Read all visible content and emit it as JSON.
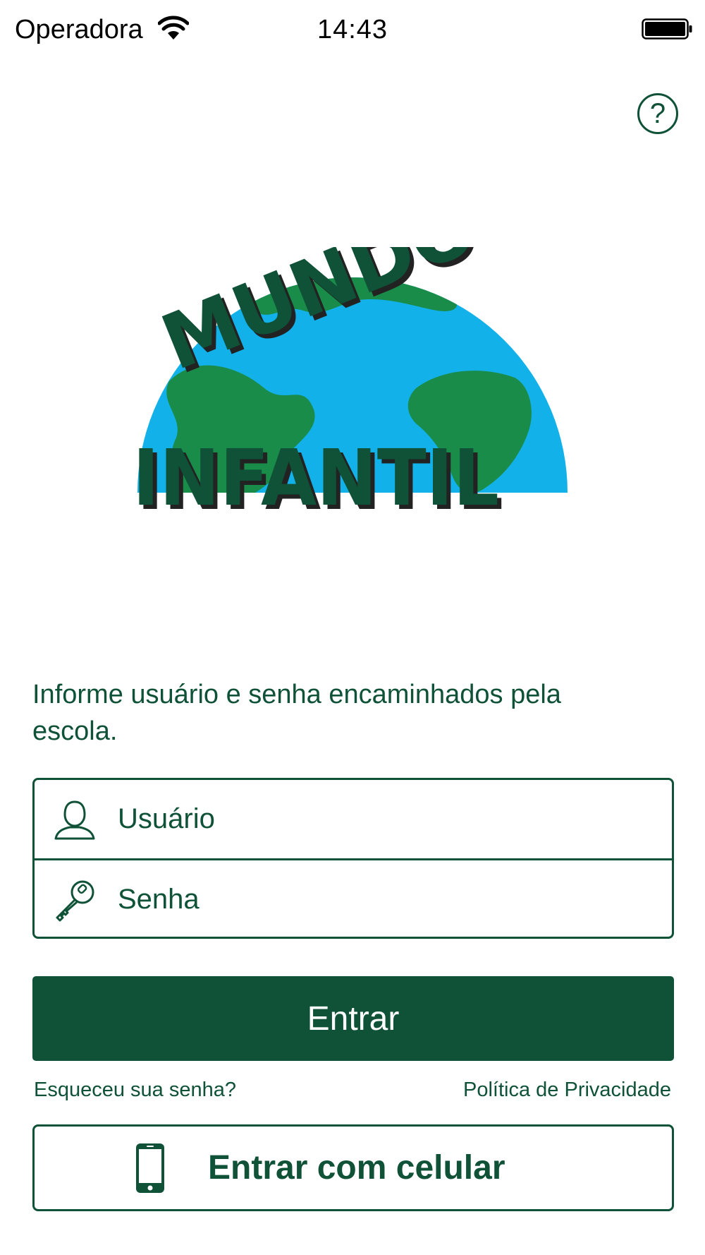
{
  "status_bar": {
    "carrier": "Operadora",
    "time": "14:43",
    "wifi_icon": "wifi-icon",
    "battery_icon": "battery-icon",
    "battery_level_percent": 95
  },
  "header": {
    "help_label": "?",
    "help_icon": "question-circle-icon"
  },
  "logo": {
    "line1": "MUNDO",
    "line2": "INFANTIL",
    "colors": {
      "ocean": "#13b1ea",
      "land": "#1a8c4a",
      "letters": "#0f5237",
      "letter_shadow": "#222222"
    }
  },
  "login": {
    "instruction": "Informe usuário e senha encaminhados pela escola.",
    "username_placeholder": "Usuário",
    "username_value": "",
    "username_icon": "user-icon",
    "password_placeholder": "Senha",
    "password_value": "",
    "password_icon": "key-icon",
    "submit_label": "Entrar",
    "forgot_password": "Esqueceu sua senha?",
    "privacy_policy": "Política de Privacidade",
    "phone_login_label": "Entrar com celular",
    "phone_icon": "mobile-phone-icon"
  },
  "theme": {
    "primary": "#0f5237",
    "background": "#ffffff",
    "button_text": "#ffffff"
  }
}
